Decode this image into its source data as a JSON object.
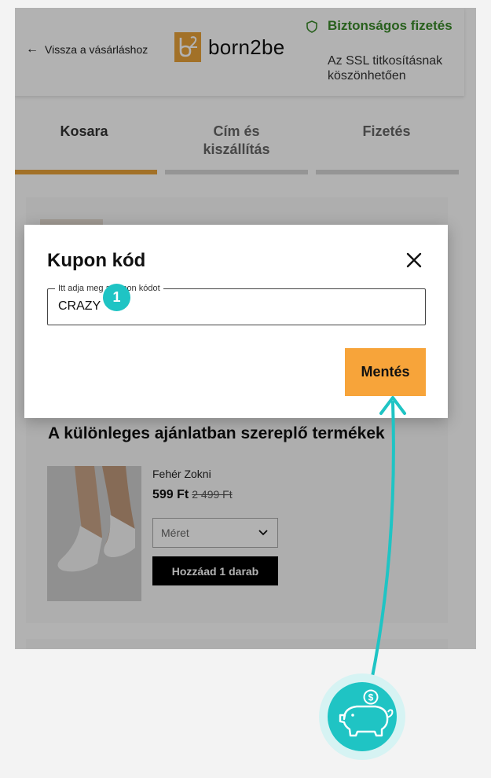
{
  "header": {
    "back_label": "Vissza a vásárláshoz",
    "back_arrow": "←",
    "logo_mark": "b2",
    "logo_word": "born2be",
    "secure_title": "Biztonságos fizetés",
    "secure_subtitle": "Az SSL titkosításnak köszönhetően"
  },
  "steps": [
    {
      "label": "Kosara"
    },
    {
      "label": "Cím és kiszállítás"
    },
    {
      "label": "Fizetés"
    }
  ],
  "promo": {
    "title": "A különleges ajánlatban szereplő termékek",
    "product_name": "Fehér Zokni",
    "price": "599 Ft",
    "old_price": "2 499 Ft",
    "size_placeholder": "Méret",
    "add_button": "Hozzáad 1 darab"
  },
  "modal": {
    "title": "Kupon kód",
    "field_label": "Itt adja meg a kupon kódot",
    "field_value": "CRAZY",
    "save_button": "Mentés"
  },
  "annotation": {
    "step_number": "1",
    "accent_color": "#1fc4c4"
  },
  "colors": {
    "brand_orange": "#e8a23a",
    "save_button": "#f7a43a",
    "secure_green": "#3a8a2a"
  }
}
